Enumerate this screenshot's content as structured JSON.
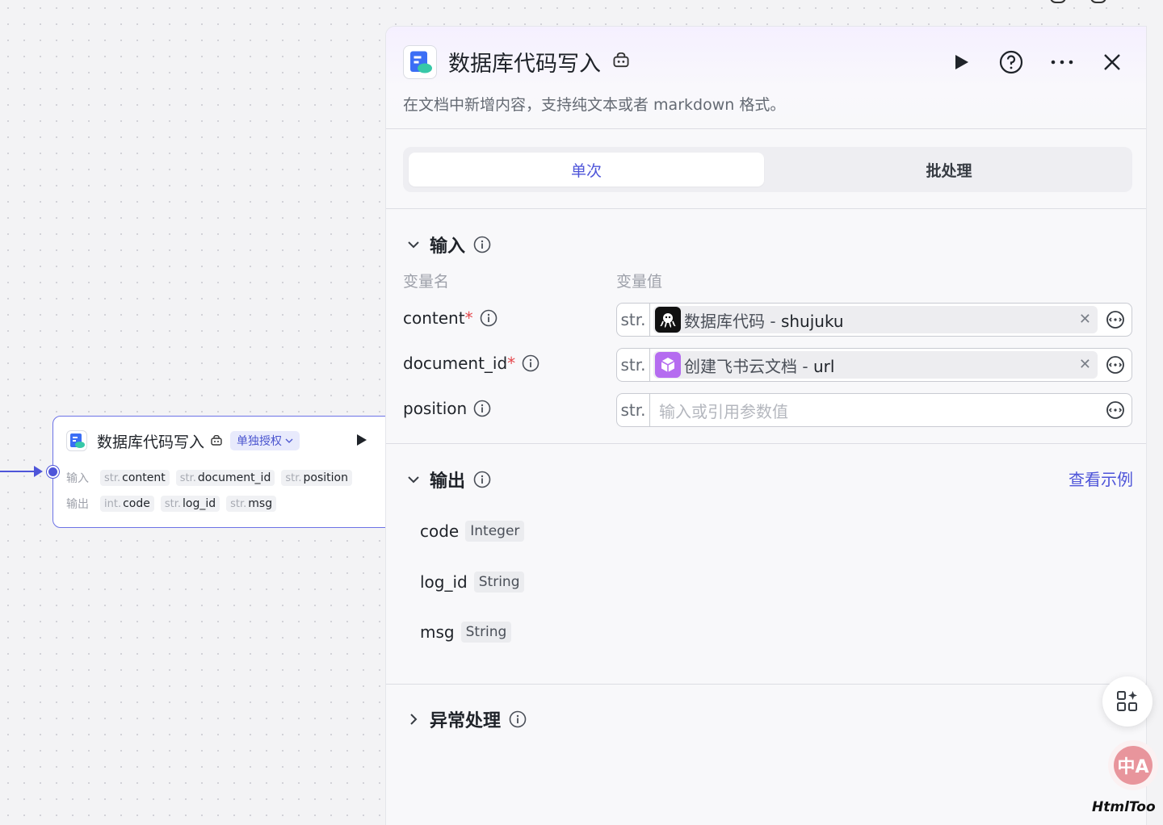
{
  "canvas": {
    "node": {
      "title": "数据库代码写入",
      "auth_badge": "单独授权",
      "inputs_label": "输入",
      "outputs_label": "输出",
      "inputs": [
        {
          "type": "str.",
          "name": "content"
        },
        {
          "type": "str.",
          "name": "document_id"
        },
        {
          "type": "str.",
          "name": "position"
        }
      ],
      "outputs": [
        {
          "type": "int.",
          "name": "code"
        },
        {
          "type": "str.",
          "name": "log_id"
        },
        {
          "type": "str.",
          "name": "msg"
        }
      ]
    }
  },
  "panel": {
    "title": "数据库代码写入",
    "description": "在文档中新增内容，支持纯文本或者 markdown 格式。",
    "header_icons": [
      "run-icon",
      "help-icon",
      "more-icon",
      "close-icon"
    ],
    "tabs": [
      "单次",
      "批处理"
    ],
    "active_tab": "单次",
    "input_section": {
      "title": "输入",
      "col_name": "变量名",
      "col_value": "变量值",
      "vars": [
        {
          "name": "content",
          "required": "*",
          "type": "str.",
          "source": "数据库代码",
          "sep": " - ",
          "field": "shujuku",
          "icon": "octopus-icon"
        },
        {
          "name": "document_id",
          "required": "*",
          "type": "str.",
          "source": "创建飞书云文档",
          "sep": " - ",
          "field": "url",
          "icon": "cube-icon"
        },
        {
          "name": "position",
          "required": "",
          "type": "str.",
          "placeholder": "输入或引用参数值"
        }
      ]
    },
    "output_section": {
      "title": "输出",
      "example_link": "查看示例",
      "vars": [
        {
          "name": "code",
          "type": "Integer"
        },
        {
          "name": "log_id",
          "type": "String"
        },
        {
          "name": "msg",
          "type": "String"
        }
      ]
    },
    "exception_section": {
      "title": "异常处理"
    }
  },
  "floating": {
    "apps_icon": "apps-sparkle-icon",
    "translate_label": "中A"
  },
  "watermark": "HtmlToo",
  "colors": {
    "accent": "#4e55d9",
    "required": "#e5484d",
    "node_border": "#6c72e6"
  }
}
